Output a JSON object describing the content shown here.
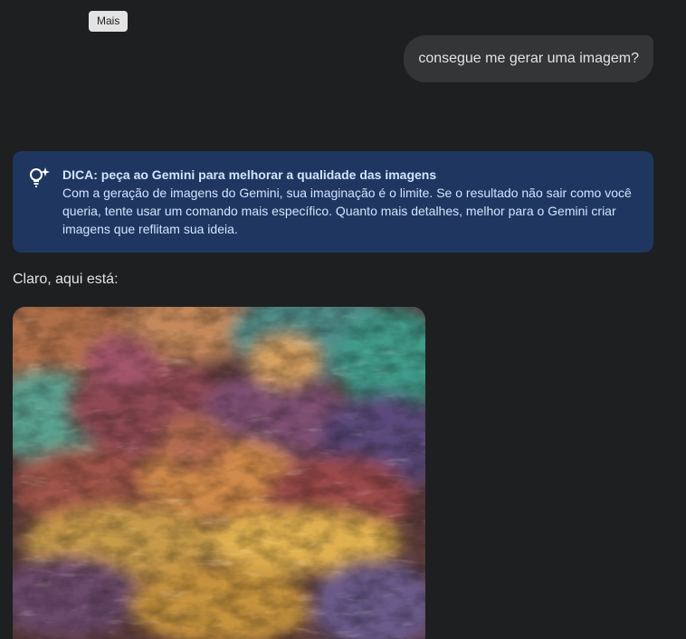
{
  "tooltip": {
    "label": "Mais"
  },
  "user_message": {
    "text": "consegue me gerar uma imagem?"
  },
  "tip": {
    "icon": "lightbulb-sparkle-icon",
    "title": "DICA: peça ao Gemini para melhorar a qualidade das imagens",
    "lines": [
      "Com a geração de imagens do Gemini, sua imaginação é o limite. Se o resultado não sair como você",
      "queria, tente usar um comando mais específico. Quanto mais detalhes, melhor para o Gemini criar",
      "imagens que reflitam sua ideia."
    ],
    "background": "#1f3760"
  },
  "response": {
    "text": "Claro, aqui está:",
    "image": {
      "description_icon": "generated-image-icon"
    }
  },
  "colors": {
    "background": "#1e1f20",
    "bubble": "#333537",
    "tooltip": "#e3e3e3"
  }
}
